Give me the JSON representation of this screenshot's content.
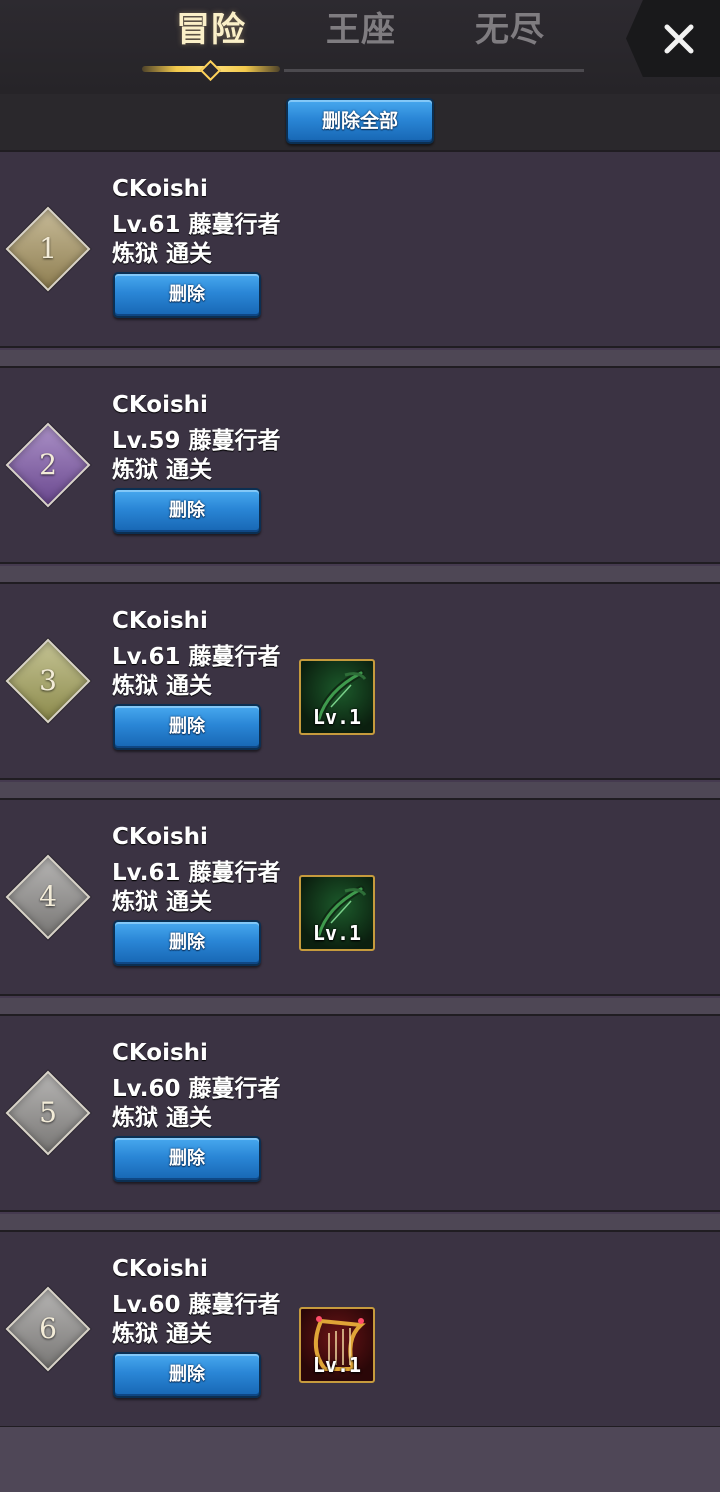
{
  "tabs": [
    {
      "label": "冒险",
      "active": true
    },
    {
      "label": "王座",
      "active": false
    },
    {
      "label": "无尽",
      "active": false
    }
  ],
  "close_icon": "close-icon",
  "delete_all_label": "删除全部",
  "entries": [
    {
      "rank": "1",
      "name": "CKoishi",
      "level": "Lv.61",
      "class": "藤蔓行者",
      "level_line": "Lv.61 藤蔓行者",
      "status": "炼狱 通关",
      "delete_label": "删除",
      "rank_color": "#a89560",
      "item": null
    },
    {
      "rank": "2",
      "name": "CKoishi",
      "level": "Lv.59",
      "class": "藤蔓行者",
      "level_line": "Lv.59 藤蔓行者",
      "status": "炼狱 通关",
      "delete_label": "删除",
      "rank_color": "#7d55a8",
      "item": null
    },
    {
      "rank": "3",
      "name": "CKoishi",
      "level": "Lv.61",
      "class": "藤蔓行者",
      "level_line": "Lv.61 藤蔓行者",
      "status": "炼狱 通关",
      "delete_label": "删除",
      "rank_color": "#a5a35a",
      "item": {
        "icon": "green-bow-icon",
        "level": "Lv.1"
      }
    },
    {
      "rank": "4",
      "name": "CKoishi",
      "level": "Lv.61",
      "class": "藤蔓行者",
      "level_line": "Lv.61 藤蔓行者",
      "status": "炼狱 通关",
      "delete_label": "删除",
      "rank_color": "#8e8c8a",
      "item": {
        "icon": "green-bow-icon",
        "level": "Lv.1"
      }
    },
    {
      "rank": "5",
      "name": "CKoishi",
      "level": "Lv.60",
      "class": "藤蔓行者",
      "level_line": "Lv.60 藤蔓行者",
      "status": "炼狱 通关",
      "delete_label": "删除",
      "rank_color": "#8e8c8a",
      "item": null
    },
    {
      "rank": "6",
      "name": "CKoishi",
      "level": "Lv.60",
      "class": "藤蔓行者",
      "level_line": "Lv.60 藤蔓行者",
      "status": "炼狱 通关",
      "delete_label": "删除",
      "rank_color": "#8e8c8a",
      "item": {
        "icon": "red-harp-icon",
        "level": "Lv.1"
      }
    }
  ],
  "colors": {
    "background": "#453a4f",
    "panel": "#3b3343",
    "accent_gold": "#f2c94c",
    "button_blue": "#2a86d6"
  }
}
